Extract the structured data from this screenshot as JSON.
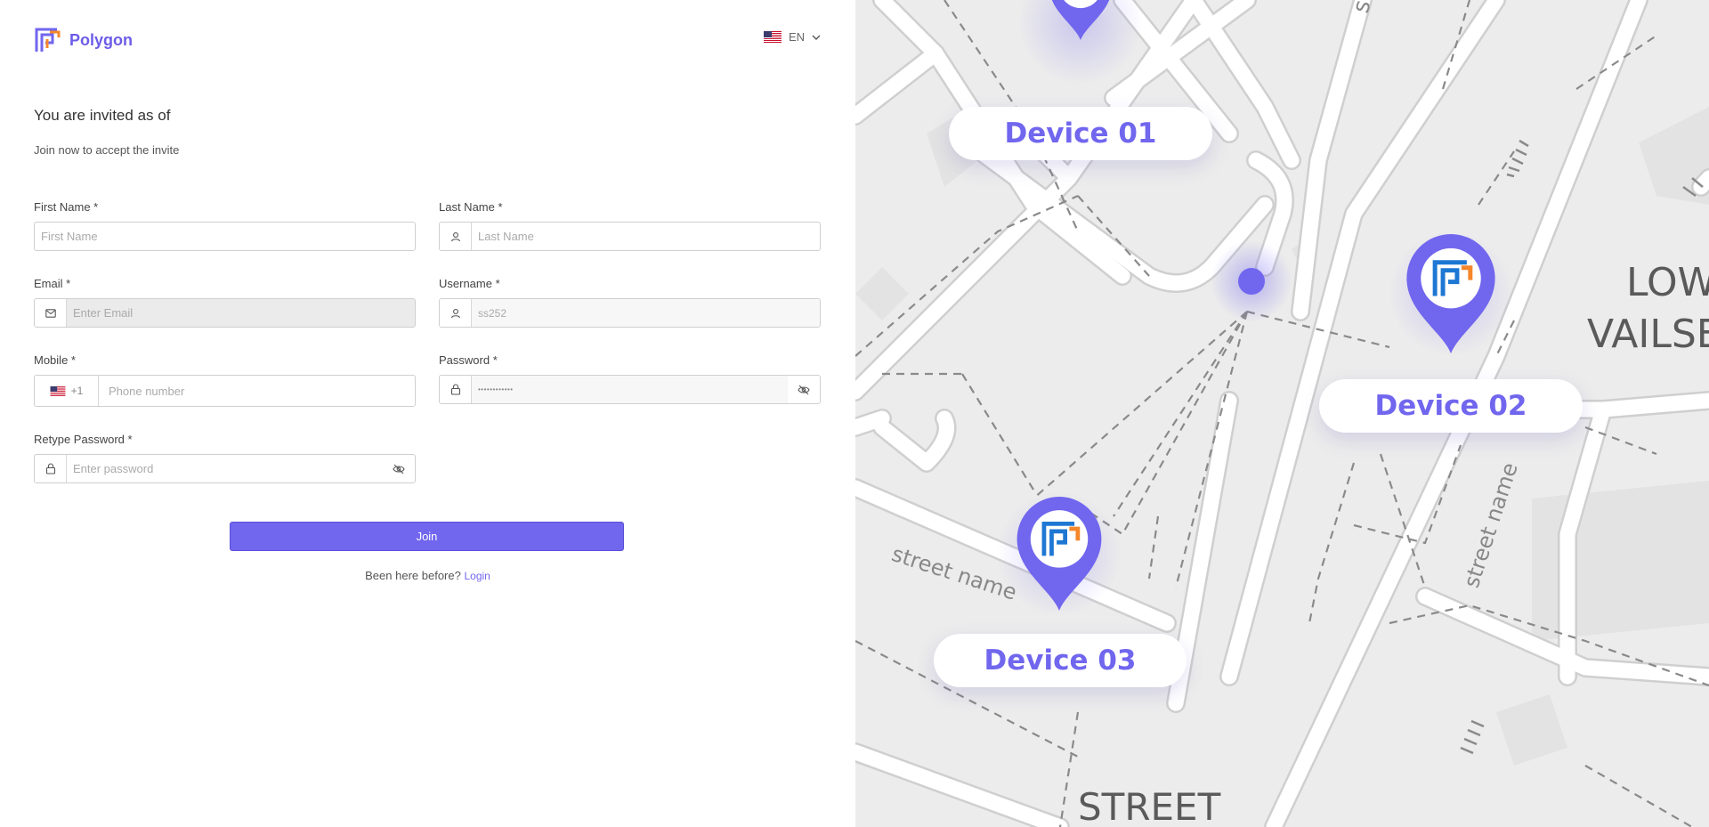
{
  "brand": {
    "name": "Polygon"
  },
  "language": {
    "code": "EN"
  },
  "header": {
    "title": "You are invited as of",
    "subtitle": "Join now to accept the invite"
  },
  "form": {
    "first_name": {
      "label": "First Name *",
      "placeholder": "First Name"
    },
    "last_name": {
      "label": "Last Name *",
      "placeholder": "Last Name"
    },
    "email": {
      "label": "Email *",
      "placeholder": "Enter Email"
    },
    "username": {
      "label": "Username *",
      "value": "ss252"
    },
    "mobile": {
      "label": "Mobile *",
      "country_code": "+1",
      "placeholder": "Phone number"
    },
    "password": {
      "label": "Password *",
      "value": "••••••••••••"
    },
    "retype_password": {
      "label": "Retype Password *",
      "placeholder": "Enter password"
    },
    "join_label": "Join",
    "footer_text": "Been here before?",
    "login_label": "Login"
  },
  "map": {
    "devices": [
      "Device 01",
      "Device 02",
      "Device 03"
    ],
    "street_labels": [
      "street name",
      "street name",
      "street name",
      "STREET",
      "LOW",
      "VAILSE"
    ]
  },
  "colors": {
    "accent": "#7166ee",
    "logo_orange": "#f5862a",
    "logo_blue": "#1e77d3",
    "map_background": "#ececec"
  }
}
